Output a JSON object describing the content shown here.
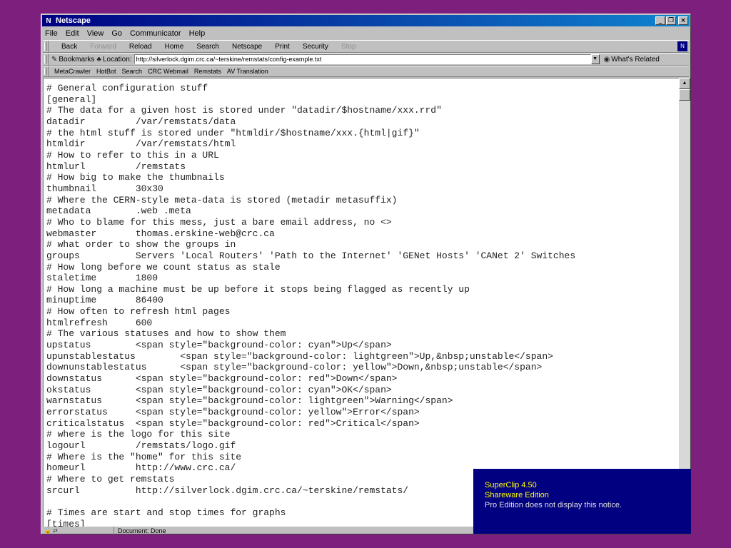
{
  "window": {
    "title": "Netscape"
  },
  "window_buttons": {
    "minimize": "_",
    "restore": "❐",
    "close": "×"
  },
  "menu": [
    {
      "label": "File"
    },
    {
      "label": "Edit"
    },
    {
      "label": "View"
    },
    {
      "label": "Go"
    },
    {
      "label": "Communicator"
    },
    {
      "label": "Help"
    }
  ],
  "toolbar": [
    {
      "label": "Back",
      "enabled": true
    },
    {
      "label": "Forward",
      "enabled": false
    },
    {
      "label": "Reload",
      "enabled": true
    },
    {
      "label": "Home",
      "enabled": true
    },
    {
      "label": "Search",
      "enabled": true
    },
    {
      "label": "Netscape",
      "enabled": true
    },
    {
      "label": "Print",
      "enabled": true
    },
    {
      "label": "Security",
      "enabled": true
    },
    {
      "label": "Stop",
      "enabled": false
    }
  ],
  "location": {
    "bookmarks_label": "Bookmarks",
    "location_label": "Location:",
    "url": "http://silverlock.dgim.crc.ca/~terskine/remstats/config-example.txt",
    "related_label": "What's Related"
  },
  "personal": [
    {
      "label": "MetaCrawler"
    },
    {
      "label": "HotBot"
    },
    {
      "label": "Search"
    },
    {
      "label": "CRC Webmail"
    },
    {
      "label": "Remstats"
    },
    {
      "label": "AV Translation"
    }
  ],
  "content": {
    "lines": [
      "# General configuration stuff",
      "[general]",
      "# The data for a given host is stored under \"datadir/$hostname/xxx.rrd\"",
      "datadir         /var/remstats/data",
      "# the html stuff is stored under \"htmldir/$hostname/xxx.{html|gif}\"",
      "htmldir         /var/remstats/html",
      "# How to refer to this in a URL",
      "htmlurl         /remstats",
      "# How big to make the thumbnails",
      "thumbnail       30x30",
      "# Where the CERN-style meta-data is stored (metadir metasuffix)",
      "metadata        .web .meta",
      "# Who to blame for this mess, just a bare email address, no <>",
      "webmaster       thomas.erskine-web@crc.ca",
      "# what order to show the groups in",
      "groups          Servers 'Local Routers' 'Path to the Internet' 'GENet Hosts' 'CANet 2' Switches",
      "# How long before we count status as stale",
      "staletime       1800",
      "# How long a machine must be up before it stops being flagged as recently up",
      "minuptime       86400",
      "# How often to refresh html pages",
      "htmlrefresh     600",
      "# The various statuses and how to show them",
      "upstatus        <span style=\"background-color: cyan\">Up</span>",
      "upunstablestatus        <span style=\"background-color: lightgreen\">Up,&nbsp;unstable</span>",
      "downunstablestatus      <span style=\"background-color: yellow\">Down,&nbsp;unstable</span>",
      "downstatus      <span style=\"background-color: red\">Down</span>",
      "okstatus        <span style=\"background-color: cyan\">OK</span>",
      "warnstatus      <span style=\"background-color: lightgreen\">Warning</span>",
      "errorstatus     <span style=\"background-color: yellow\">Error</span>",
      "criticalstatus  <span style=\"background-color: red\">Critical</span>",
      "# where is the logo for this site",
      "logourl         /remstats/logo.gif",
      "# Where is the \"home\" for this site",
      "homeurl         http://www.crc.ca/",
      "# Where to get remstats",
      "srcurl          http://silverlock.dgim.crc.ca/~terskine/remstats/",
      "",
      "# Times are start and stop times for graphs",
      "[times]"
    ]
  },
  "status": {
    "text": "Document: Done"
  },
  "superclip": {
    "line1": "SuperClip  4.50",
    "line2": "Shareware Edition",
    "line3": "Pro Edition does not display this notice."
  },
  "colors": {
    "desktop": "#7d1f7d",
    "titlebar": "#000080",
    "superclip_bg": "#000080",
    "superclip_text": "#ffff00"
  }
}
